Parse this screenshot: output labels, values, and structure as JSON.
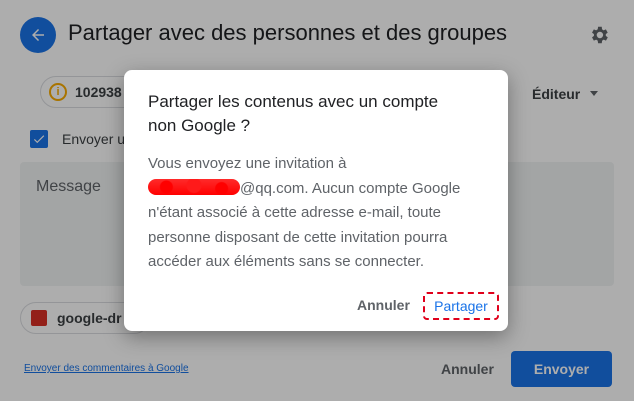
{
  "header": {
    "title": "Partager avec des personnes et des groupes"
  },
  "recipient_chip": {
    "text": "102938"
  },
  "role_select": {
    "value": "Éditeur"
  },
  "notify": {
    "label": "Envoyer u"
  },
  "message": {
    "placeholder": "Message"
  },
  "attachment": {
    "name": "google-dr"
  },
  "footer": {
    "feedback_link": "Envoyer des commentaires à Google",
    "cancel": "Annuler",
    "send": "Envoyer"
  },
  "dialog": {
    "title": "Partager les contenus avec un compte non Google ?",
    "body_line1": "Vous envoyez une invitation à",
    "email_suffix": "@qq.com.",
    "body_rest": " Aucun compte Google n'étant associé à cette adresse e-mail, toute personne disposant de cette invitation pourra accéder aux éléments sans se connecter.",
    "cancel": "Annuler",
    "share": "Partager"
  },
  "colors": {
    "accent": "#1a73e8",
    "highlight": "#e0001b"
  }
}
